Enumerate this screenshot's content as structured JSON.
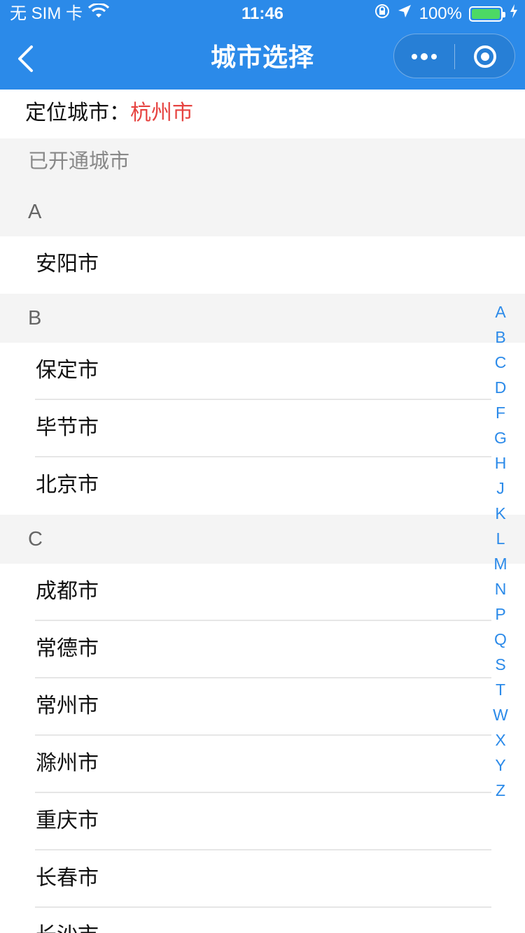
{
  "status": {
    "carrier": "无 SIM 卡",
    "time": "11:46",
    "battery": "100%"
  },
  "nav": {
    "title": "城市选择"
  },
  "location": {
    "label": "定位城市：",
    "city": "杭州市"
  },
  "opened_title": "已开通城市",
  "groups": [
    {
      "letter": "A",
      "cities": [
        "安阳市"
      ]
    },
    {
      "letter": "B",
      "cities": [
        "保定市",
        "毕节市",
        "北京市"
      ]
    },
    {
      "letter": "C",
      "cities": [
        "成都市",
        "常德市",
        "常州市",
        "滁州市",
        "重庆市",
        "长春市",
        "长沙市"
      ]
    }
  ],
  "index_letters": [
    "A",
    "B",
    "C",
    "D",
    "F",
    "G",
    "H",
    "J",
    "K",
    "L",
    "M",
    "N",
    "P",
    "Q",
    "S",
    "T",
    "W",
    "X",
    "Y",
    "Z"
  ],
  "colors": {
    "brand": "#2b8ae9",
    "located_city": "#e64340"
  }
}
